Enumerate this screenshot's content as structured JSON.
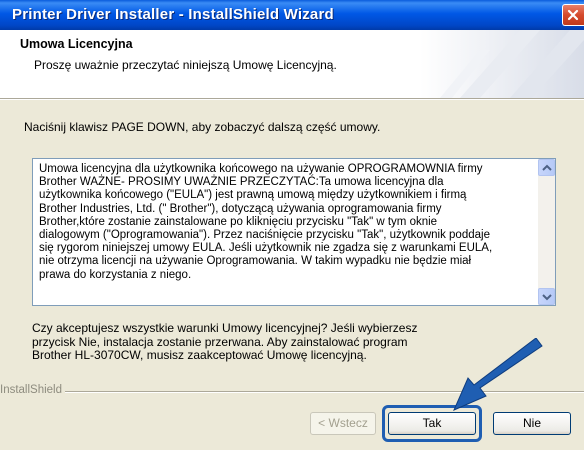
{
  "window": {
    "title": "Printer Driver Installer - InstallShield Wizard"
  },
  "header": {
    "title": "Umowa Licencyjna",
    "subtitle": "Proszę uważnie przeczytać niniejszą Umowę Licencyjną."
  },
  "instruction": "Naciśnij klawisz PAGE DOWN, aby zobaczyć dalszą część umowy.",
  "license": {
    "text": "Umowa licencyjna dla użytkownika końcowego na używanie OPROGRAMOWNIA firmy\nBrother WAŻNE- PROSIMY UWAŻNIE PRZECZYTAĆ:Ta umowa licencyjna dla\nużytkownika końcowego (\"EULA\") jest prawną umową między użytkownikiem i firmą\nBrother Industries, Ltd. (\" Brother\"), dotyczącą używania oprogramowania firmy\nBrother,które zostanie zainstalowane po kliknięciu przycisku \"Tak\" w tym oknie\ndialogowym (\"Oprogramowania\"). Przez naciśnięcie przycisku \"Tak\", użytkownik poddaje\nsię rygorom niniejszej umowy EULA. Jeśli użytkownik nie zgadza się z warunkami EULA,\nnie otrzyma licencji na używanie Oprogramowania. W takim wypadku nie będzie miał\nprawa do korzystania z niego."
  },
  "question": "Czy akceptujesz wszystkie warunki Umowy licencyjnej? Jeśli wybierzesz\nprzycisk Nie, instalacja zostanie przerwana. Aby zainstalować program\nBrother HL-3070CW, musisz zaakceptować Umowę licencyjną.",
  "footer": {
    "brand": "InstallShield",
    "back_label": "< Wstecz",
    "yes_label": "Tak",
    "no_label": "Nie"
  },
  "colors": {
    "titlebar": "#0058e6",
    "arrow": "#1f5eb2",
    "dialog_bg": "#ece9d8"
  }
}
